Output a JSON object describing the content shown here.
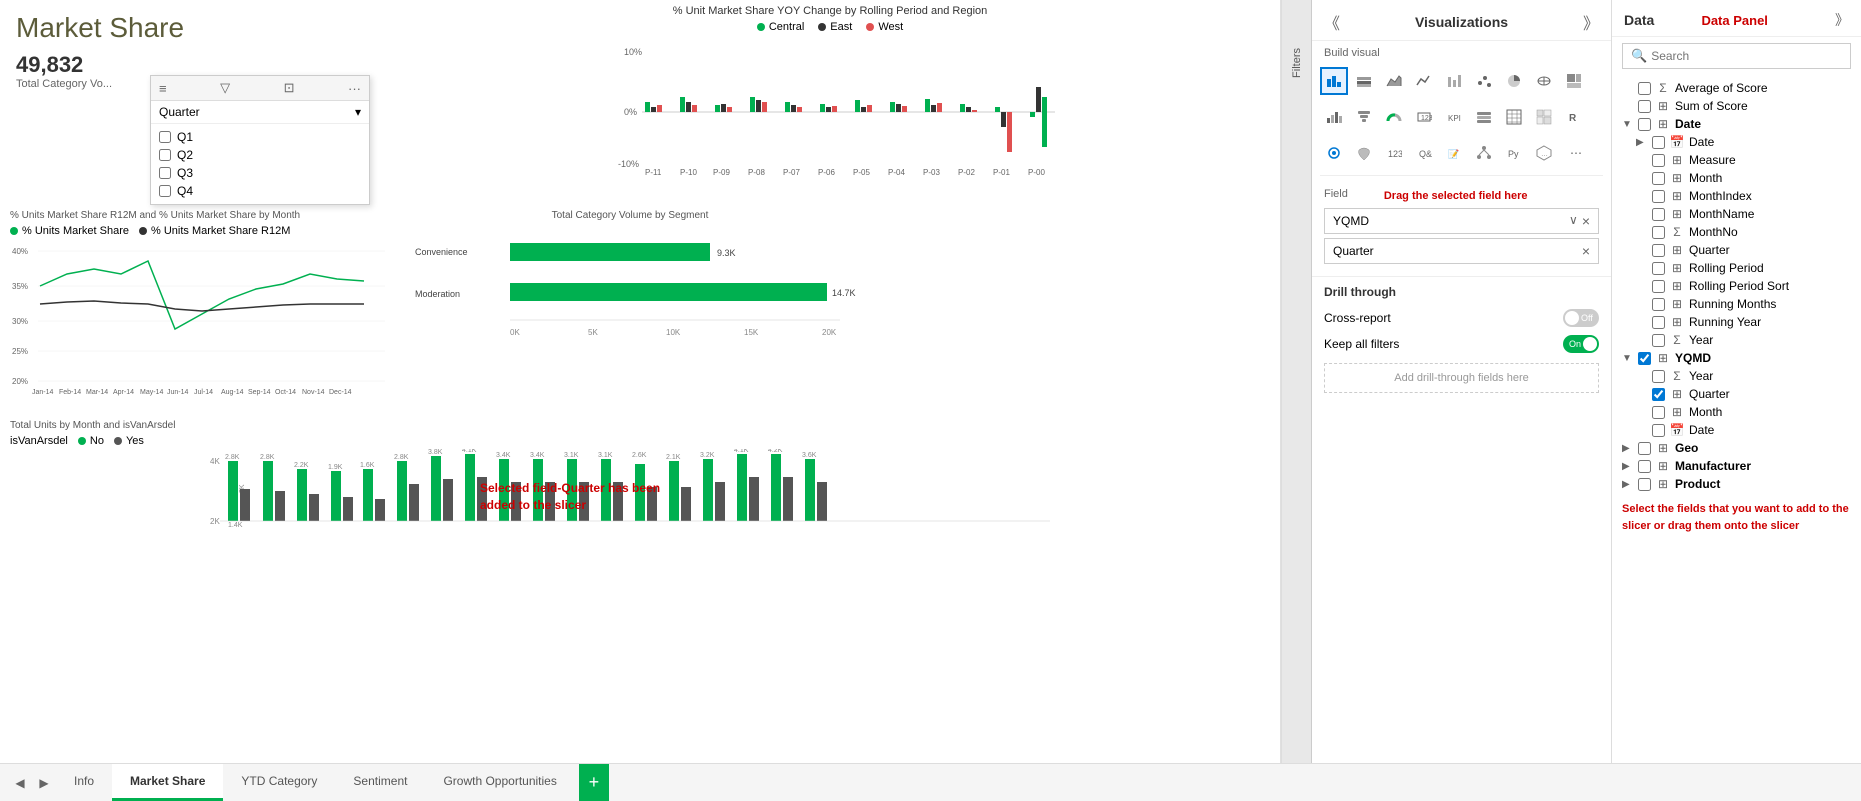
{
  "title": "Market Share",
  "metric": {
    "value": "49,832",
    "label": "Total Category Vo..."
  },
  "slicer": {
    "title": "Quarter",
    "items": [
      "Q1",
      "Q2",
      "Q3",
      "Q4"
    ]
  },
  "chart_yoy": {
    "title": "% Unit Market Share YOY Change by Rolling Period and Region",
    "legend": [
      {
        "label": "Central",
        "color": "#00b050"
      },
      {
        "label": "East",
        "color": "#333"
      },
      {
        "label": "West",
        "color": "#e05050"
      }
    ],
    "x_labels": [
      "P-11",
      "P-10",
      "P-09",
      "P-08",
      "P-07",
      "P-06",
      "P-05",
      "P-04",
      "P-03",
      "P-02",
      "P-01",
      "P-00"
    ],
    "y_labels": [
      "10%",
      "0%",
      "-10%"
    ]
  },
  "chart_segment": {
    "title": "Total Category Volume by Segment",
    "bars": [
      {
        "label": "Convenience",
        "value": "9.3K",
        "width": 0.63
      },
      {
        "label": "Moderation",
        "value": "14.7K",
        "width": 1.0
      }
    ],
    "x_labels": [
      "0K",
      "5K",
      "10K",
      "15K",
      "20K"
    ]
  },
  "chart_line": {
    "title": "% Units Market Share R12M and % Units Market Share by Month",
    "legend": [
      {
        "label": "% Units Market Share",
        "color": "#00b050"
      },
      {
        "label": "% Units Market Share R12M",
        "color": "#333"
      }
    ],
    "y_labels": [
      "40%",
      "35%",
      "30%",
      "25%",
      "20%"
    ],
    "x_labels": [
      "Jan-14",
      "Feb-14",
      "Mar-14",
      "Apr-14",
      "May-14",
      "Jun-14",
      "Jul-14",
      "Aug-14",
      "Sep-14",
      "Oct-14",
      "Nov-14",
      "Dec-14"
    ]
  },
  "chart_monthly": {
    "title": "Total Units by Month and isVanArsdel",
    "legend": [
      {
        "label": "No",
        "color": "#00b050"
      },
      {
        "label": "Yes",
        "color": "#333"
      }
    ]
  },
  "annotations": {
    "slicer_text": "Selected field-Quarter has\nbeen added to the slicer",
    "drag_text": "Drag the selected\nfield here",
    "data_panel_text": "Data Panel",
    "select_text": "Select the fields that you\nwant to add to the slicer\nor drag them onto the\nslicer"
  },
  "viz_panel": {
    "title": "Visualizations",
    "build_visual": "Build visual",
    "field_label": "Field",
    "fields": [
      "YQMD",
      "Quarter"
    ],
    "drill": {
      "title": "Drill through",
      "cross_report": "Cross-report",
      "cross_report_state": "Off",
      "keep_filters": "Keep all filters",
      "keep_filters_state": "On",
      "placeholder": "Add drill-through fields here"
    }
  },
  "data_panel": {
    "title": "Data",
    "search_placeholder": "Search",
    "items": [
      {
        "level": 0,
        "type": "checkbox",
        "icon": "sigma",
        "label": "Average of Score"
      },
      {
        "level": 0,
        "type": "checkbox",
        "icon": "table",
        "label": "Sum of Score"
      },
      {
        "level": 0,
        "type": "group",
        "icon": "folder",
        "label": "Date",
        "expanded": true
      },
      {
        "level": 1,
        "type": "group",
        "icon": "calendar",
        "label": "Date",
        "expanded": false
      },
      {
        "level": 1,
        "type": "checkbox",
        "icon": "table",
        "label": "Measure"
      },
      {
        "level": 1,
        "type": "checkbox",
        "icon": "table",
        "label": "Month"
      },
      {
        "level": 1,
        "type": "checkbox",
        "icon": "table",
        "label": "MonthIndex"
      },
      {
        "level": 1,
        "type": "checkbox",
        "icon": "table",
        "label": "MonthName"
      },
      {
        "level": 1,
        "type": "checkbox",
        "icon": "sigma",
        "label": "MonthNo"
      },
      {
        "level": 1,
        "type": "checkbox",
        "icon": "table",
        "label": "Quarter"
      },
      {
        "level": 1,
        "type": "checkbox",
        "icon": "table",
        "label": "Rolling Period"
      },
      {
        "level": 1,
        "type": "checkbox",
        "icon": "table",
        "label": "Rolling Period Sort"
      },
      {
        "level": 1,
        "type": "checkbox",
        "icon": "table",
        "label": "Running Months"
      },
      {
        "level": 1,
        "type": "checkbox",
        "icon": "table",
        "label": "Running Year"
      },
      {
        "level": 1,
        "type": "checkbox",
        "icon": "sigma",
        "label": "Year"
      },
      {
        "level": 0,
        "type": "group",
        "icon": "folder",
        "label": "YQMD",
        "expanded": true,
        "checked": true
      },
      {
        "level": 1,
        "type": "checkbox",
        "icon": "sigma",
        "label": "Year"
      },
      {
        "level": 1,
        "type": "checkbox_checked",
        "icon": "table",
        "label": "Quarter"
      },
      {
        "level": 1,
        "type": "checkbox",
        "icon": "table",
        "label": "Month"
      },
      {
        "level": 1,
        "type": "checkbox",
        "icon": "calendar",
        "label": "Date"
      },
      {
        "level": 0,
        "type": "group",
        "icon": "folder",
        "label": "Geo",
        "expanded": false
      },
      {
        "level": 0,
        "type": "group",
        "icon": "folder",
        "label": "Manufacturer",
        "expanded": false
      },
      {
        "level": 0,
        "type": "group",
        "icon": "folder",
        "label": "Product",
        "expanded": false
      }
    ]
  },
  "tabs": {
    "items": [
      "Info",
      "Market Share",
      "YTD Category",
      "Sentiment",
      "Growth Opportunities"
    ],
    "active": "Market Share"
  }
}
